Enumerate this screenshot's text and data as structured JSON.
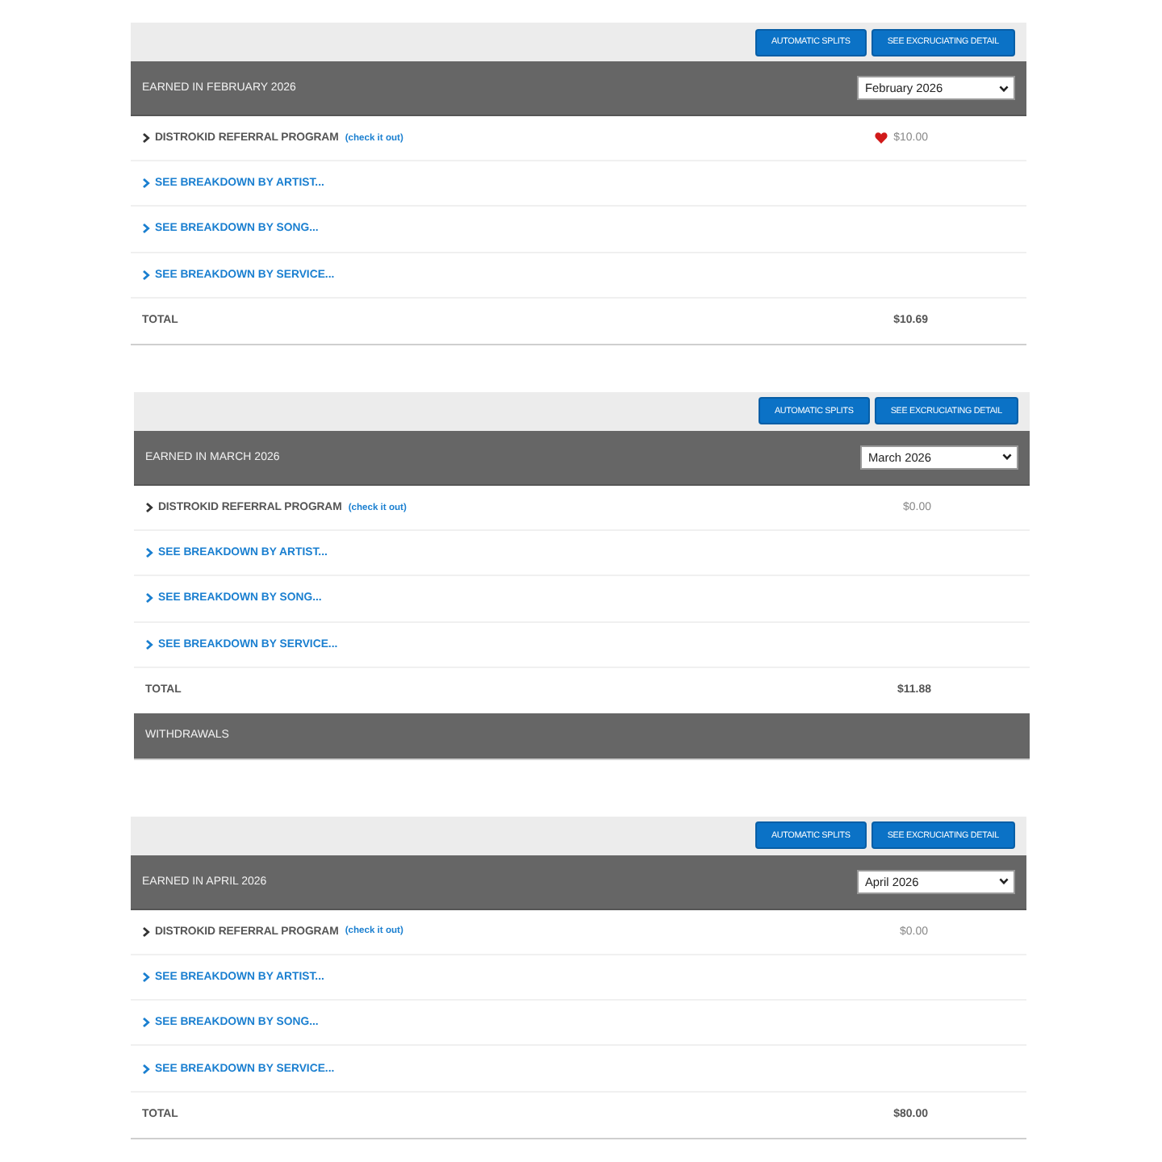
{
  "panels": [
    {
      "buttons": [
        "AUTOMATIC SPLITS",
        "SEE EXCRUCIATING DETAIL"
      ],
      "title": "EARNED IN FEBRUARY 2026",
      "month_select": {
        "value": "February 2026"
      },
      "rows": [
        {
          "kind": "referral",
          "label": "DISTROKID REFERRAL PROGRAM",
          "link": "(check it out)",
          "amount": "$10.00",
          "heart": true
        },
        {
          "kind": "breakdown",
          "label": "SEE BREAKDOWN BY ARTIST..."
        },
        {
          "kind": "breakdown",
          "label": "SEE BREAKDOWN BY SONG..."
        },
        {
          "kind": "breakdown",
          "label": "SEE BREAKDOWN BY SERVICE..."
        },
        {
          "kind": "total",
          "label": "TOTAL",
          "amount": "$10.69"
        }
      ]
    },
    {
      "buttons": [
        "AUTOMATIC SPLITS",
        "SEE EXCRUCIATING DETAIL"
      ],
      "title": "EARNED IN MARCH 2026",
      "month_select": {
        "value": "March 2026"
      },
      "rows": [
        {
          "kind": "referral",
          "label": "DISTROKID REFERRAL PROGRAM",
          "link": "(check it out)",
          "amount": "$0.00",
          "heart": false
        },
        {
          "kind": "breakdown",
          "label": "SEE BREAKDOWN BY ARTIST..."
        },
        {
          "kind": "breakdown",
          "label": "SEE BREAKDOWN BY SONG..."
        },
        {
          "kind": "breakdown",
          "label": "SEE BREAKDOWN BY SERVICE..."
        },
        {
          "kind": "total",
          "label": "TOTAL",
          "amount": "$11.88"
        }
      ],
      "section_header": "WITHDRAWALS"
    },
    {
      "buttons": [
        "AUTOMATIC SPLITS",
        "SEE EXCRUCIATING DETAIL"
      ],
      "title": "EARNED IN APRIL 2026",
      "month_select": {
        "value": "April 2026"
      },
      "rows": [
        {
          "kind": "referral",
          "label": "DISTROKID REFERRAL PROGRAM",
          "link": "(check it out)",
          "amount": "$0.00",
          "heart": false
        },
        {
          "kind": "breakdown",
          "label": "SEE BREAKDOWN BY ARTIST..."
        },
        {
          "kind": "breakdown",
          "label": "SEE BREAKDOWN BY SONG..."
        },
        {
          "kind": "breakdown",
          "label": "SEE BREAKDOWN BY SERVICE..."
        },
        {
          "kind": "total",
          "label": "TOTAL",
          "amount": "$80.00"
        }
      ]
    }
  ]
}
